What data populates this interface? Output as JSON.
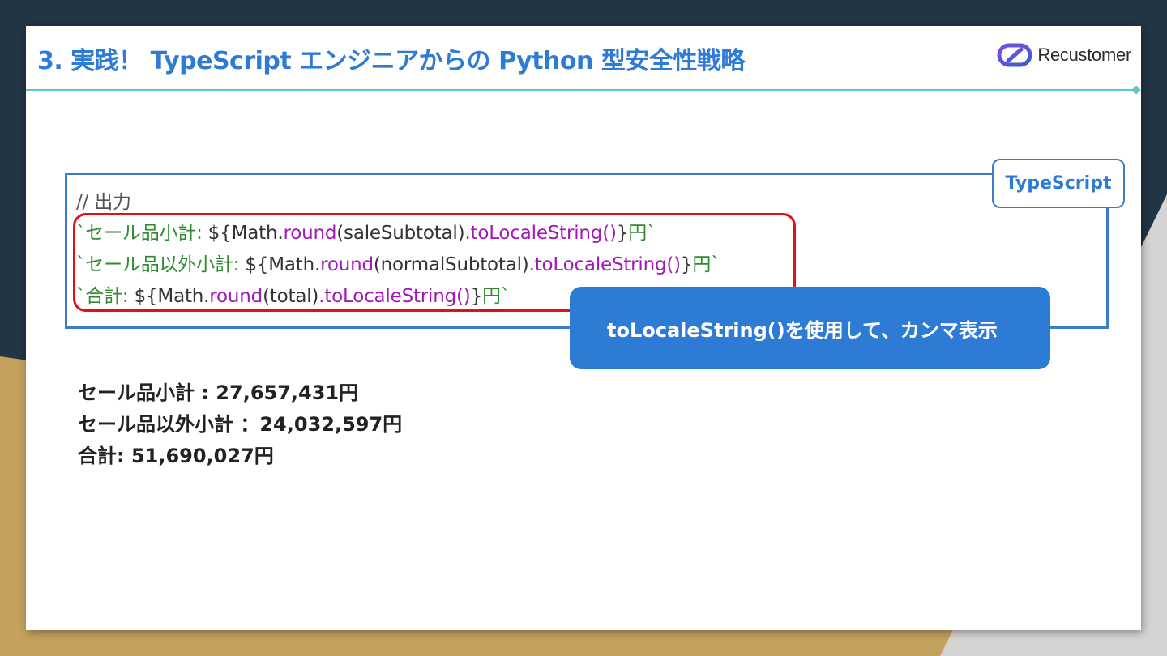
{
  "slide": {
    "title": "3. 実践！ TypeScript エンジニアからの  Python 型安全性戦略",
    "logo_text": "Recustomer",
    "code_tab_label": "TypeScript",
    "code": {
      "comment": "// 出力",
      "lines": [
        {
          "p1": "`セール品小計: ",
          "p2": "${Math.",
          "p3": "round",
          "p4": "(saleSubtotal)",
          "p5": ".toLocaleString()",
          "p6": "}",
          "p7": "円`"
        },
        {
          "p1": "`セール品以外小計: ",
          "p2": "${Math.",
          "p3": "round",
          "p4": "(normalSubtotal)",
          "p5": ".toLocaleString()",
          "p6": "}",
          "p7": "円`"
        },
        {
          "p1": "`合計: ",
          "p2": "${Math.",
          "p3": "round",
          "p4": "(total)",
          "p5": ".toLocaleString()",
          "p6": "}",
          "p7": "円`"
        }
      ]
    },
    "callout": "toLocaleString()を使用して、カンマ表示",
    "results": [
      "セール品小計 : 27,657,431円",
      "セール品以外小計 ：24,032,597円",
      "合計: 51,690,027円"
    ],
    "colors": {
      "accent": "#2e7bd6",
      "highlight_frame": "#e0101a",
      "code_green": "#2f8a2f",
      "code_purple": "#a219b8",
      "rule": "#5fc6c8"
    }
  }
}
